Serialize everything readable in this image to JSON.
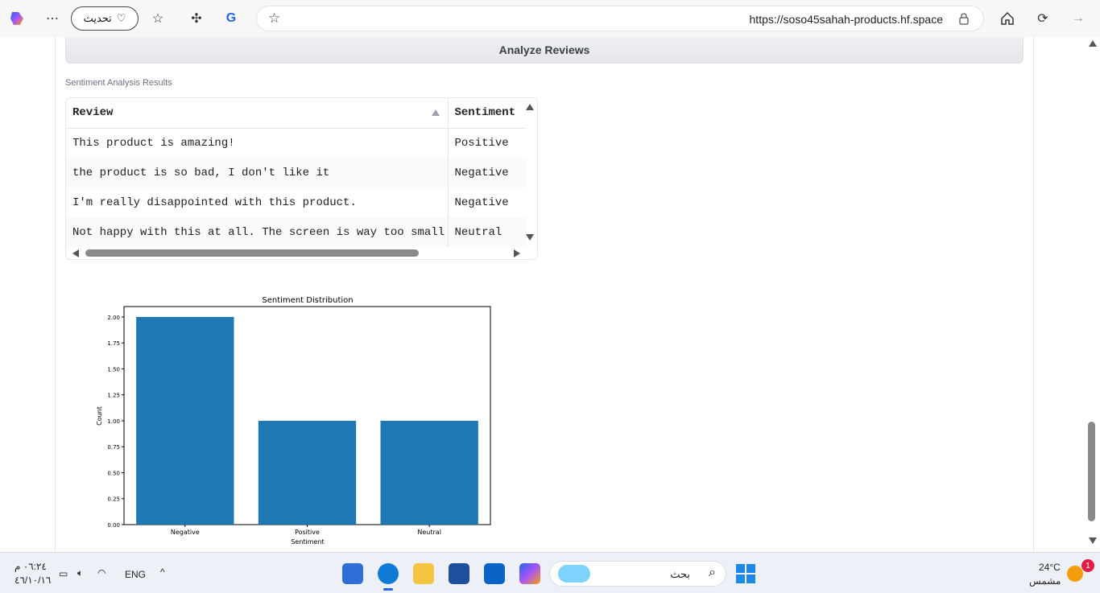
{
  "browser": {
    "update_label": "تحديث",
    "url": "https://soso45sahah-products.hf.space"
  },
  "app": {
    "analyze_button": "Analyze Reviews",
    "results_label": "Sentiment Analysis Results"
  },
  "table": {
    "headers": [
      "Review",
      "Sentiment"
    ],
    "rows": [
      [
        "This product is amazing!",
        "Positive"
      ],
      [
        "the product is so bad, I don't like it",
        "Negative"
      ],
      [
        "I'm really disappointed with this product.",
        "Negative"
      ],
      [
        "Not happy with this at all. The screen is way too small",
        "Neutral"
      ]
    ]
  },
  "chart_data": {
    "type": "bar",
    "title": "Sentiment Distribution",
    "xlabel": "Sentiment",
    "ylabel": "Count",
    "categories": [
      "Negative",
      "Positive",
      "Neutral"
    ],
    "values": [
      2,
      1,
      1
    ],
    "ylim": [
      0,
      2.1
    ],
    "yticks": [
      "0.00",
      "0.25",
      "0.50",
      "0.75",
      "1.00",
      "1.25",
      "1.50",
      "1.75",
      "2.00"
    ],
    "bar_color": "#1f77b4",
    "grid": false
  },
  "taskbar": {
    "time": "٠٦:٢٤ م",
    "date": "٤٦/١٠/١٦",
    "language": "ENG",
    "search_placeholder": "بحث",
    "temperature": "24°C",
    "weather": "مشمس",
    "notification_count": "1"
  }
}
